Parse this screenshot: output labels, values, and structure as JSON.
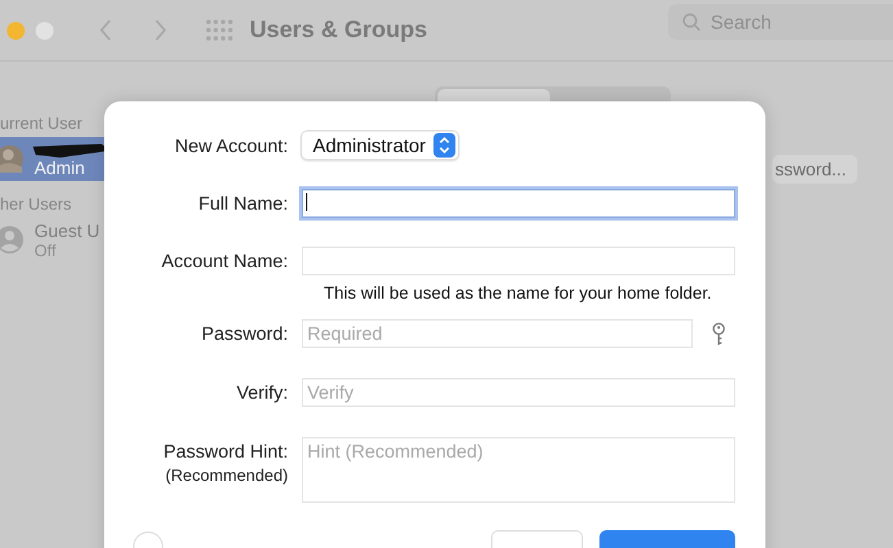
{
  "window": {
    "title": "Users & Groups",
    "search": {
      "placeholder": "Search"
    }
  },
  "sidebar": {
    "sections": [
      {
        "heading": "urrent User",
        "users": [
          {
            "name": "Admin",
            "selected": true,
            "redacted": true
          }
        ]
      },
      {
        "heading": "her Users",
        "users": [
          {
            "name": "Guest U",
            "status": "Off",
            "selected": false,
            "redacted": false
          }
        ]
      }
    ]
  },
  "change_password_button": "ssword...",
  "dialog": {
    "account_type": {
      "label": "New Account:",
      "value": "Administrator"
    },
    "fields": [
      {
        "kind": "text",
        "label": "Full Name:",
        "focused": true
      },
      {
        "kind": "text",
        "label": "Account Name:",
        "note": "This will be used as the name for your home folder.",
        "focused": false
      },
      {
        "kind": "password",
        "label": "Password:",
        "placeholder": "Required",
        "focused": false
      },
      {
        "kind": "text",
        "label": "Verify:",
        "placeholder": "Verify",
        "focused": false
      },
      {
        "kind": "textarea",
        "label": "Password Hint:",
        "sublabel": "(Recommended)",
        "placeholder": "Hint (Recommended)",
        "focused": false
      }
    ]
  }
}
